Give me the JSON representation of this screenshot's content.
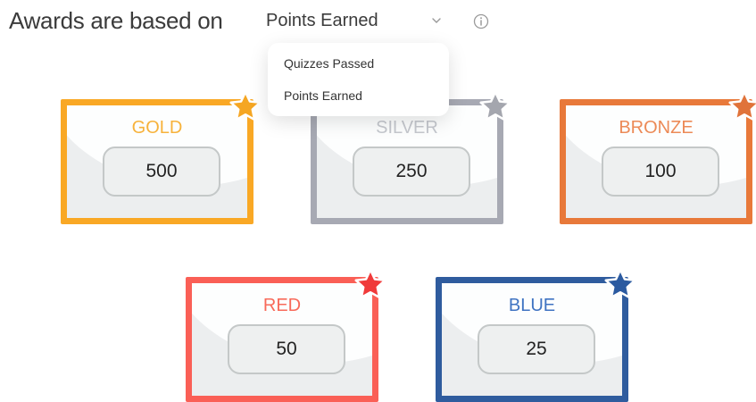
{
  "header": {
    "title": "Awards are based on"
  },
  "select": {
    "value": "Points Earned",
    "icon": "chevron-down-icon"
  },
  "info": {
    "icon": "info-icon"
  },
  "dropdown": {
    "options": [
      "Quizzes Passed",
      "Points Earned"
    ]
  },
  "cards": [
    {
      "key": "gold",
      "label": "GOLD",
      "value": "500",
      "border": "#f9a825",
      "label_color": "#f7b23b",
      "star": "#f5a623"
    },
    {
      "key": "silver",
      "label": "SILVER",
      "value": "250",
      "border": "#a7a9b3",
      "label_color": "#c5c8ce",
      "star": "#a4a6ae"
    },
    {
      "key": "bronze",
      "label": "BRONZE",
      "value": "100",
      "border": "#e8793a",
      "label_color": "#ec8a57",
      "star": "#e0733a"
    },
    {
      "key": "red",
      "label": "RED",
      "value": "50",
      "border": "#fa5f56",
      "label_color": "#f86a5a",
      "star": "#f03a3a"
    },
    {
      "key": "blue",
      "label": "BLUE",
      "value": "25",
      "border": "#2f5c9e",
      "label_color": "#3f73c2",
      "star": "#2b5aa0"
    }
  ]
}
